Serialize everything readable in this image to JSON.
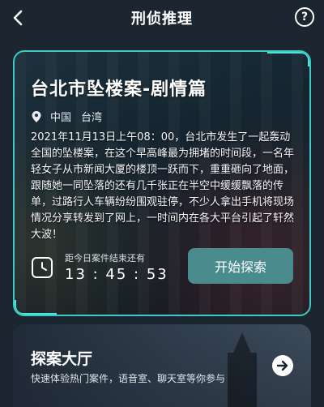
{
  "header": {
    "title": "刑侦推理",
    "help_label": "?"
  },
  "case": {
    "title": "台北市坠楼案-剧情篇",
    "location": [
      "中国",
      "台湾"
    ],
    "description": "2021年11月13日上午08：00，台北市发生了一起轰动全国的坠楼案，在这个早高峰最为拥堵的时间段，一名年轻女子从市新闻大厦的楼顶一跃而下，重重砸向了地面，跟随她一同坠落的还有几千张正在半空中缓缓飘落的传单，过路行人车辆纷纷围观驻停，不少人拿出手机将现场情况分享转发到了网上，一时间内在各大平台引起了轩然大波！",
    "timer_label": "距今日案件结束还有",
    "timer_value": "13 : 45 : 53",
    "start_button": "开始探索"
  },
  "hall": {
    "title": "探案大厅",
    "subtitle": "快速体验热门案件，语音室、聊天室等你参与"
  },
  "colors": {
    "background": "#1c2630",
    "accent": "#3fc9c4",
    "button": "#4a8c8e"
  }
}
